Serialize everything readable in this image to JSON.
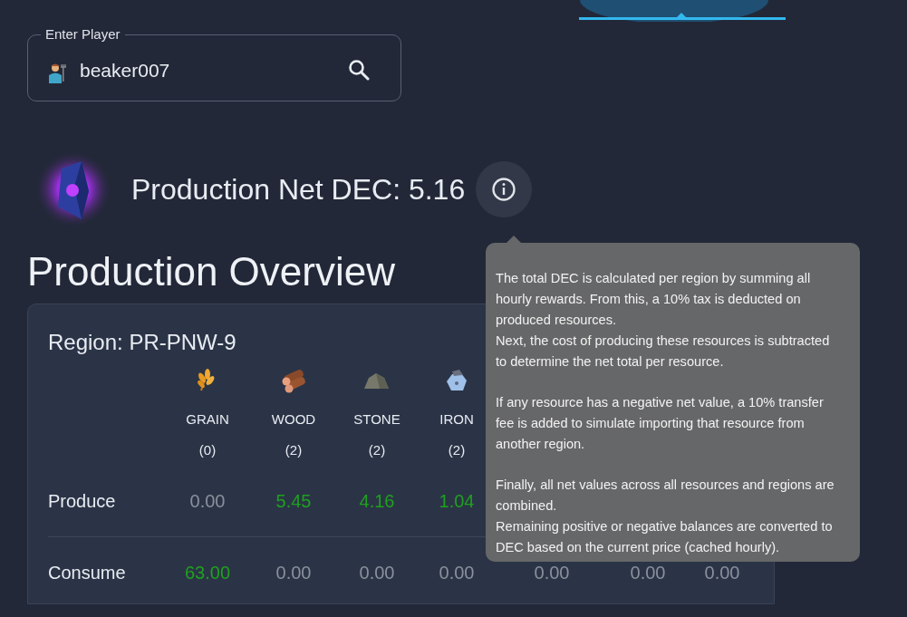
{
  "player_field": {
    "label": "Enter Player",
    "value": "beaker007"
  },
  "net_dec": {
    "title": "Production Net DEC: 5.16"
  },
  "tooltip": {
    "paragraphs": [
      "The total DEC is calculated per region by summing all hourly rewards. From this, a 10% tax is deducted on produced resources.\nNext, the cost of producing these resources is subtracted to determine the net total per resource.",
      "If any resource has a negative net value, a 10% transfer fee is added to simulate importing that resource from another region.",
      "Finally, all net values across all resources and regions are combined.\nRemaining positive or negative balances are converted to DEC based on the current price (cached hourly)."
    ]
  },
  "heading": "Production Overview",
  "region": {
    "title": "Region: PR-PNW-9",
    "row_labels": [
      "Produce",
      "Consume"
    ],
    "resources": [
      {
        "kind": "grain",
        "name": "GRAIN",
        "count": "(0)",
        "produce": {
          "value": "0.00",
          "positive": false
        },
        "consume": {
          "value": "63.00",
          "positive": true
        }
      },
      {
        "kind": "wood",
        "name": "WOOD",
        "count": "(2)",
        "produce": {
          "value": "5.45",
          "positive": true
        },
        "consume": {
          "value": "0.00",
          "positive": false
        }
      },
      {
        "kind": "stone",
        "name": "STONE",
        "count": "(2)",
        "produce": {
          "value": "4.16",
          "positive": true
        },
        "consume": {
          "value": "0.00",
          "positive": false
        }
      },
      {
        "kind": "iron",
        "name": "IRON",
        "count": "(2)",
        "produce": {
          "value": "1.04",
          "positive": true
        },
        "consume": {
          "value": "0.00",
          "positive": false
        }
      },
      {
        "consume": {
          "value": "0.00",
          "positive": false
        }
      },
      {
        "consume": {
          "value": "0.00",
          "positive": false
        }
      },
      {
        "consume": {
          "value": "0.00",
          "positive": false
        }
      }
    ]
  }
}
